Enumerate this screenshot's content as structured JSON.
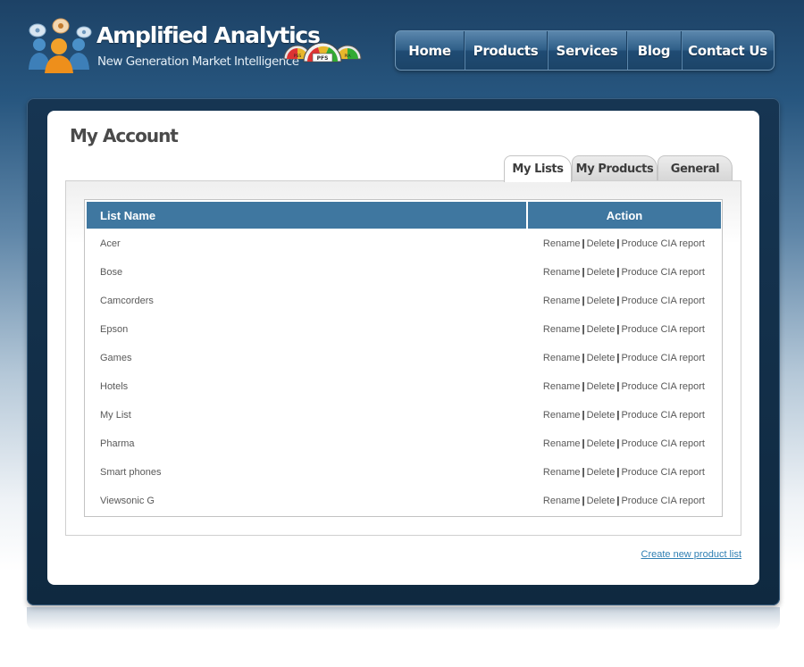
{
  "brand": {
    "name": "Amplified Analytics",
    "tagline": "New Generation Market Intelligence",
    "gauge_labels": [
      "PSS",
      "PFS",
      "PIA"
    ]
  },
  "nav": {
    "items": [
      "Home",
      "Products",
      "Services",
      "Blog",
      "Contact Us"
    ]
  },
  "page": {
    "title": "My Account"
  },
  "tabs": {
    "items": [
      "My Lists",
      "My Products",
      "General"
    ],
    "active": "My Lists"
  },
  "table": {
    "headers": {
      "name": "List Name",
      "action": "Action"
    },
    "actions": {
      "rename": "Rename",
      "delete": "Delete",
      "report": "Produce CIA report",
      "separator": "|"
    },
    "rows": [
      {
        "name": "Acer"
      },
      {
        "name": "Bose"
      },
      {
        "name": "Camcorders"
      },
      {
        "name": "Epson"
      },
      {
        "name": "Games"
      },
      {
        "name": "Hotels"
      },
      {
        "name": "My List"
      },
      {
        "name": "Pharma"
      },
      {
        "name": "Smart phones"
      },
      {
        "name": "Viewsonic G"
      }
    ]
  },
  "footer": {
    "create_link": "Create new product list"
  },
  "colors": {
    "header_bg": "#1d4266",
    "nav_button": "#2f5f88",
    "table_header": "#3f77a0",
    "link": "#2f7fb3",
    "frame": "#163552"
  }
}
